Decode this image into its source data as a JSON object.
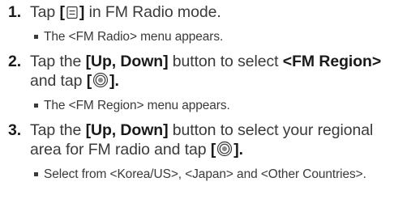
{
  "steps": [
    {
      "num": "1.",
      "pre": "Tap ",
      "bracket_open": "[",
      "icon": "menu-icon",
      "bracket_close": "]",
      "post": " in FM Radio mode.",
      "note": "The <FM Radio> menu appears."
    },
    {
      "num": "2.",
      "pre": "Tap the ",
      "bold1": "[Up, Down]",
      "mid": " button to select ",
      "bold2": "<FM Region>",
      "mid2": " and tap ",
      "bracket_open": "[",
      "icon": "select-icon",
      "bracket_close": "].",
      "note": "The <FM Region> menu appears."
    },
    {
      "num": "3.",
      "pre": "Tap the ",
      "bold1": "[Up, Down]",
      "mid": " button to select your regional area for FM radio and tap ",
      "bracket_open": "[",
      "icon": "select-icon",
      "bracket_close": "].",
      "note": "Select from <Korea/US>, <Japan> and <Other Countries>."
    }
  ]
}
